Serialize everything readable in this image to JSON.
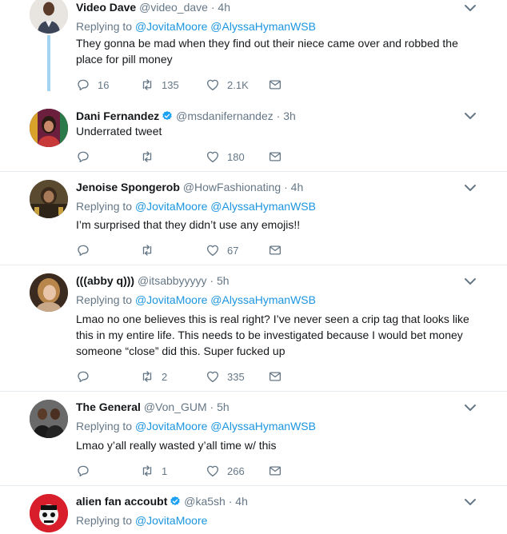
{
  "replying_label": "Replying to",
  "tweets": [
    {
      "name": "Video Dave",
      "handle": "@video_dave",
      "time": "4h",
      "verified": false,
      "reply_to": [
        "@JovitaMoore",
        "@AlyssaHymanWSB"
      ],
      "text": "They gonna be mad when they find out their niece came over and robbed the place for pill money",
      "replies": "16",
      "retweets": "135",
      "likes": "2.1K"
    },
    {
      "name": "Dani Fernandez",
      "handle": "@msdanifernandez",
      "time": "3h",
      "verified": true,
      "reply_to": [],
      "text": "Underrated tweet",
      "replies": "",
      "retweets": "",
      "likes": "180"
    },
    {
      "name": "Jenoise Spongerob",
      "handle": "@HowFashionating",
      "time": "4h",
      "verified": false,
      "reply_to": [
        "@JovitaMoore",
        "@AlyssaHymanWSB"
      ],
      "text": "I’m surprised that they didn’t use any emojis!!",
      "replies": "",
      "retweets": "",
      "likes": "67"
    },
    {
      "name": "(((abby q)))",
      "handle": "@itsabbyyyyy",
      "time": "5h",
      "verified": false,
      "reply_to": [
        "@JovitaMoore",
        "@AlyssaHymanWSB"
      ],
      "text_lines": [
        "Lmao no one believes this is real right? I’ve never seen a crip tag that looks like",
        "this in my entire life. This needs to be investigated because I would bet money",
        "someone “close” did this. Super fucked up"
      ],
      "replies": "",
      "retweets": "2",
      "likes": "335"
    },
    {
      "name": "The General",
      "handle": "@Von_GUM",
      "time": "5h",
      "verified": false,
      "reply_to": [
        "@JovitaMoore",
        "@AlyssaHymanWSB"
      ],
      "text": "Lmao y’all really wasted y’all time w/ this",
      "replies": "",
      "retweets": "1",
      "likes": "266"
    },
    {
      "name": "alien fan accoubt",
      "handle": "@ka5sh",
      "time": "4h",
      "verified": true,
      "reply_to": [
        "@JovitaMoore"
      ]
    }
  ],
  "colors": {
    "link": "#1b95e0",
    "muted": "#657786",
    "verified": "#1da1f2",
    "thread": "#a3d4f2",
    "divider": "#e6ecf0"
  }
}
